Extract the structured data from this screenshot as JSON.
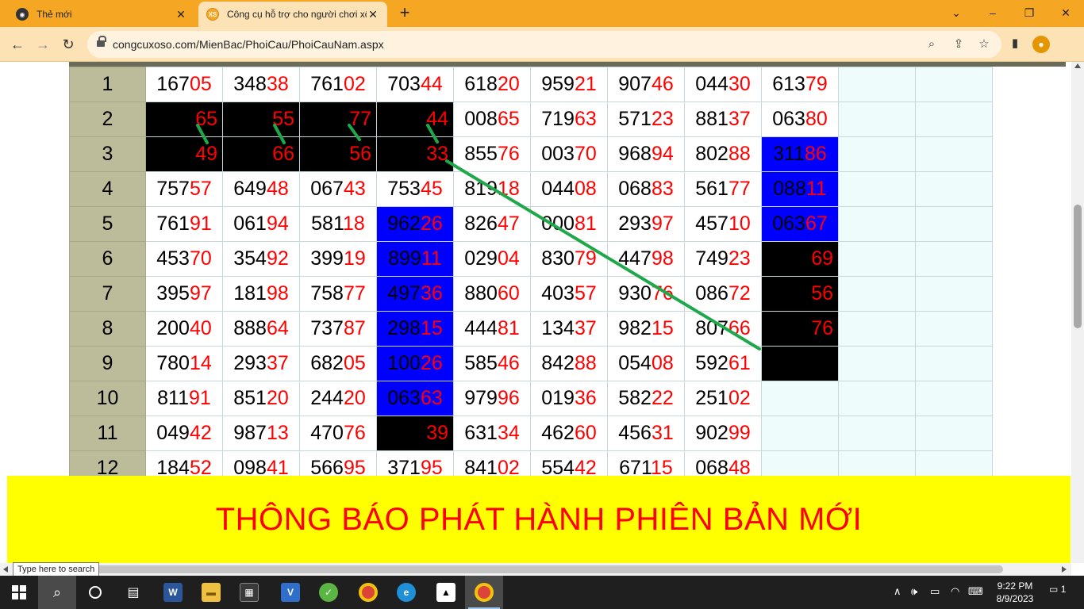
{
  "browser": {
    "tabs": [
      {
        "label": "Thẻ mới",
        "favicon": "chrome-icon",
        "active": false
      },
      {
        "label": "Công cụ hỗ trợ cho người chơi xổ số",
        "favicon": "xs-icon",
        "active": true
      }
    ],
    "favicon_text": "XS",
    "url": "congcuxoso.com/MienBac/PhoiCau/PhoiCauNam.aspx",
    "controls": {
      "minimize": "⌄",
      "restore": "–",
      "maximize": "❐",
      "close": "✕"
    }
  },
  "grid": {
    "columns": 11,
    "rows": [
      {
        "label": "1",
        "cells": [
          [
            "167",
            "05"
          ],
          [
            "348",
            "38"
          ],
          [
            "761",
            "02"
          ],
          [
            "703",
            "44"
          ],
          [
            "618",
            "20"
          ],
          [
            "959",
            "21"
          ],
          [
            "907",
            "46"
          ],
          [
            "044",
            "30"
          ],
          [
            "613",
            "79"
          ],
          [
            "",
            ""
          ],
          [
            "",
            ""
          ]
        ],
        "style": [
          "w",
          "w",
          "w",
          "w",
          "w",
          "w",
          "w",
          "w",
          "w",
          "emp",
          "emp"
        ]
      },
      {
        "label": "2",
        "cells": [
          [
            "",
            "65"
          ],
          [
            "",
            "55"
          ],
          [
            "",
            "77"
          ],
          [
            "",
            "44"
          ],
          [
            "008",
            "65"
          ],
          [
            "719",
            "63"
          ],
          [
            "571",
            "23"
          ],
          [
            "881",
            "37"
          ],
          [
            "063",
            "80"
          ],
          [
            "",
            ""
          ],
          [
            "",
            ""
          ]
        ],
        "style": [
          "blk",
          "blk",
          "blk",
          "blk",
          "w",
          "w",
          "w",
          "w",
          "w",
          "emp",
          "emp"
        ]
      },
      {
        "label": "3",
        "cells": [
          [
            "",
            "49"
          ],
          [
            "",
            "66"
          ],
          [
            "",
            "56"
          ],
          [
            "",
            "33"
          ],
          [
            "855",
            "76"
          ],
          [
            "003",
            "70"
          ],
          [
            "968",
            "94"
          ],
          [
            "802",
            "88"
          ],
          [
            "311",
            "86"
          ],
          [
            "",
            ""
          ],
          [
            "",
            ""
          ]
        ],
        "style": [
          "blk",
          "blk",
          "blk",
          "blk",
          "w",
          "w",
          "w",
          "w",
          "blu",
          "emp",
          "emp"
        ]
      },
      {
        "label": "4",
        "cells": [
          [
            "757",
            "57"
          ],
          [
            "649",
            "48"
          ],
          [
            "067",
            "43"
          ],
          [
            "753",
            "45"
          ],
          [
            "819",
            "18"
          ],
          [
            "044",
            "08"
          ],
          [
            "068",
            "83"
          ],
          [
            "561",
            "77"
          ],
          [
            "088",
            "11"
          ],
          [
            "",
            ""
          ],
          [
            "",
            ""
          ]
        ],
        "style": [
          "w",
          "w",
          "w",
          "w",
          "w",
          "w",
          "w",
          "w",
          "blu",
          "emp",
          "emp"
        ]
      },
      {
        "label": "5",
        "cells": [
          [
            "761",
            "91"
          ],
          [
            "061",
            "94"
          ],
          [
            "581",
            "18"
          ],
          [
            "962",
            "26"
          ],
          [
            "826",
            "47"
          ],
          [
            "000",
            "81"
          ],
          [
            "293",
            "97"
          ],
          [
            "457",
            "10"
          ],
          [
            "063",
            "67"
          ],
          [
            "",
            ""
          ],
          [
            "",
            ""
          ]
        ],
        "style": [
          "w",
          "w",
          "w",
          "blu",
          "w",
          "w",
          "w",
          "w",
          "blu",
          "emp",
          "emp"
        ]
      },
      {
        "label": "6",
        "cells": [
          [
            "453",
            "70"
          ],
          [
            "354",
            "92"
          ],
          [
            "399",
            "19"
          ],
          [
            "899",
            "11"
          ],
          [
            "029",
            "04"
          ],
          [
            "830",
            "79"
          ],
          [
            "447",
            "98"
          ],
          [
            "749",
            "23"
          ],
          [
            "",
            "69"
          ],
          [
            "",
            ""
          ],
          [
            "",
            ""
          ]
        ],
        "style": [
          "w",
          "w",
          "w",
          "blu",
          "w",
          "w",
          "w",
          "w",
          "blk",
          "emp",
          "emp"
        ]
      },
      {
        "label": "7",
        "cells": [
          [
            "395",
            "97"
          ],
          [
            "181",
            "98"
          ],
          [
            "758",
            "77"
          ],
          [
            "497",
            "36"
          ],
          [
            "880",
            "60"
          ],
          [
            "403",
            "57"
          ],
          [
            "930",
            "76"
          ],
          [
            "086",
            "72"
          ],
          [
            "",
            "56"
          ],
          [
            "",
            ""
          ],
          [
            "",
            ""
          ]
        ],
        "style": [
          "w",
          "w",
          "w",
          "blu",
          "w",
          "w",
          "w",
          "w",
          "blk",
          "emp",
          "emp"
        ]
      },
      {
        "label": "8",
        "cells": [
          [
            "200",
            "40"
          ],
          [
            "888",
            "64"
          ],
          [
            "737",
            "87"
          ],
          [
            "298",
            "15"
          ],
          [
            "444",
            "81"
          ],
          [
            "134",
            "37"
          ],
          [
            "982",
            "15"
          ],
          [
            "807",
            "66"
          ],
          [
            "",
            "76"
          ],
          [
            "",
            ""
          ],
          [
            "",
            ""
          ]
        ],
        "style": [
          "w",
          "w",
          "w",
          "blu",
          "w",
          "w",
          "w",
          "w",
          "blk",
          "emp",
          "emp"
        ]
      },
      {
        "label": "9",
        "cells": [
          [
            "780",
            "14"
          ],
          [
            "293",
            "37"
          ],
          [
            "682",
            "05"
          ],
          [
            "100",
            "26"
          ],
          [
            "585",
            "46"
          ],
          [
            "842",
            "88"
          ],
          [
            "054",
            "08"
          ],
          [
            "592",
            "61"
          ],
          [
            "",
            ""
          ],
          [
            "",
            ""
          ],
          [
            "",
            ""
          ]
        ],
        "style": [
          "w",
          "w",
          "w",
          "blu",
          "w",
          "w",
          "w",
          "w",
          "blk",
          "emp",
          "emp"
        ]
      },
      {
        "label": "10",
        "cells": [
          [
            "811",
            "91"
          ],
          [
            "851",
            "20"
          ],
          [
            "244",
            "20"
          ],
          [
            "063",
            "63"
          ],
          [
            "979",
            "96"
          ],
          [
            "019",
            "36"
          ],
          [
            "582",
            "22"
          ],
          [
            "251",
            "02"
          ],
          [
            "",
            ""
          ],
          [
            "",
            ""
          ],
          [
            "",
            ""
          ]
        ],
        "style": [
          "w",
          "w",
          "w",
          "blu",
          "w",
          "w",
          "w",
          "w",
          "emp",
          "emp",
          "emp"
        ]
      },
      {
        "label": "11",
        "cells": [
          [
            "049",
            "42"
          ],
          [
            "987",
            "13"
          ],
          [
            "470",
            "76"
          ],
          [
            "",
            "39"
          ],
          [
            "631",
            "34"
          ],
          [
            "462",
            "60"
          ],
          [
            "456",
            "31"
          ],
          [
            "902",
            "99"
          ],
          [
            "",
            ""
          ],
          [
            "",
            ""
          ],
          [
            "",
            ""
          ]
        ],
        "style": [
          "w",
          "w",
          "w",
          "blk",
          "w",
          "w",
          "w",
          "w",
          "emp",
          "emp",
          "emp"
        ]
      },
      {
        "label": "12",
        "cells": [
          [
            "184",
            "52"
          ],
          [
            "098",
            "41"
          ],
          [
            "566",
            "95"
          ],
          [
            "371",
            "95"
          ],
          [
            "841",
            "02"
          ],
          [
            "554",
            "42"
          ],
          [
            "671",
            "15"
          ],
          [
            "068",
            "48"
          ],
          [
            "",
            ""
          ],
          [
            "",
            ""
          ],
          [
            "",
            ""
          ]
        ],
        "style": [
          "w",
          "w",
          "w",
          "w",
          "w",
          "w",
          "w",
          "w",
          "emp",
          "emp",
          "emp"
        ]
      }
    ]
  },
  "annotation_color": "#1fa84a",
  "banner": {
    "text": "THÔNG BÁO PHÁT HÀNH PHIÊN BẢN MỚI"
  },
  "taskbar": {
    "search_tooltip": "Type here to search",
    "time": "9:22 PM",
    "date": "8/9/2023",
    "notification_count": "1",
    "apps": [
      "word-icon",
      "file-explorer-icon",
      "store-icon",
      "app-icon",
      "app-icon-2",
      "chrome-icon",
      "edge-icon",
      "photos-icon",
      "chrome-profile-icon"
    ]
  }
}
